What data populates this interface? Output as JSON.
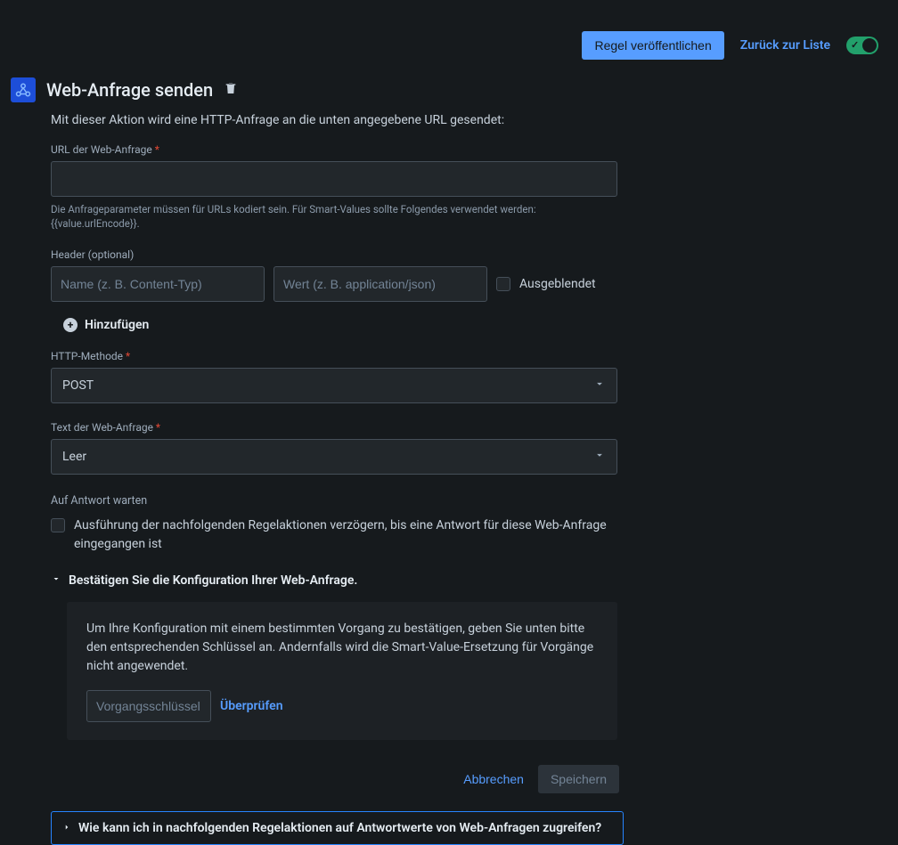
{
  "header": {
    "publish_label": "Regel veröffentlichen",
    "back_label": "Zurück zur Liste"
  },
  "page": {
    "title": "Web-Anfrage senden",
    "description": "Mit dieser Aktion wird eine HTTP-Anfrage an die unten angegebene URL gesendet:"
  },
  "url_field": {
    "label": "URL der Web-Anfrage",
    "value": "",
    "helper": "Die Anfrageparameter müssen für URLs kodiert sein. Für Smart-Values sollte Folgendes verwendet werden: {{value.urlEncode}}."
  },
  "headers": {
    "label": "Header (optional)",
    "name_placeholder": "Name (z. B. Content-Typ)",
    "value_placeholder": "Wert (z. B. application/json)",
    "hidden_label": "Ausgeblendet",
    "add_label": "Hinzufügen"
  },
  "method": {
    "label": "HTTP-Methode",
    "value": "POST"
  },
  "body": {
    "label": "Text der Web-Anfrage",
    "value": "Leer"
  },
  "wait": {
    "section_label": "Auf Antwort warten",
    "delay_text": "Ausführung der nachfolgenden Regelaktionen verzögern, bis eine Antwort für diese Web-Anfrage eingegangen ist"
  },
  "confirm": {
    "expand_label": "Bestätigen Sie die Konfiguration Ihrer Web-Anfrage.",
    "text": "Um Ihre Konfiguration mit einem bestimmten Vorgang zu bestätigen, geben Sie unten bitte den entsprechenden Schlüssel an. Andernfalls wird die Smart-Value-Ersetzung für Vorgänge nicht angewendet.",
    "key_placeholder": "Vorgangsschlüssel (op",
    "verify_label": "Überprüfen"
  },
  "footer": {
    "cancel_label": "Abbrechen",
    "save_label": "Speichern"
  },
  "help": {
    "expand_label": "Wie kann ich in nachfolgenden Regelaktionen auf Antwortwerte von Web-Anfragen zugreifen?"
  }
}
